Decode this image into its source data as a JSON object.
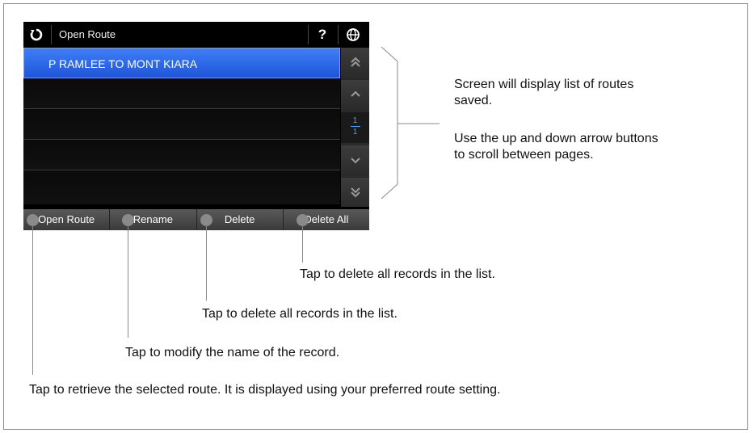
{
  "titlebar": {
    "title": "Open Route",
    "help": "?"
  },
  "routes": [
    "P RAMLEE TO MONT KIARA",
    "",
    "",
    "",
    ""
  ],
  "scroll": {
    "page_current": "1",
    "page_total": "1"
  },
  "bottom_buttons": {
    "open_route": "Open Route",
    "rename": "Rename",
    "delete": "Delete",
    "delete_all": "Delete All"
  },
  "annotations": {
    "list_desc": "Screen will display list of routes saved.",
    "arrows_desc": "Use the up and down arrow buttons to scroll between pages.",
    "delete_all_desc": "Tap to delete all records in the list.",
    "delete_desc": "Tap to delete all records in the list.",
    "rename_desc": "Tap to modify the name of the record.",
    "open_desc": "Tap to retrieve the selected route. It is displayed using your preferred route setting."
  },
  "colors": {
    "selected_row": "#2b66e6",
    "page_indicator": "#3fa2ff",
    "callout_line": "#8a8a8a"
  },
  "icons": [
    "back-arrow-icon",
    "help-icon",
    "globe-icon",
    "double-chevron-up-icon",
    "chevron-up-icon",
    "chevron-down-icon",
    "double-chevron-down-icon"
  ]
}
